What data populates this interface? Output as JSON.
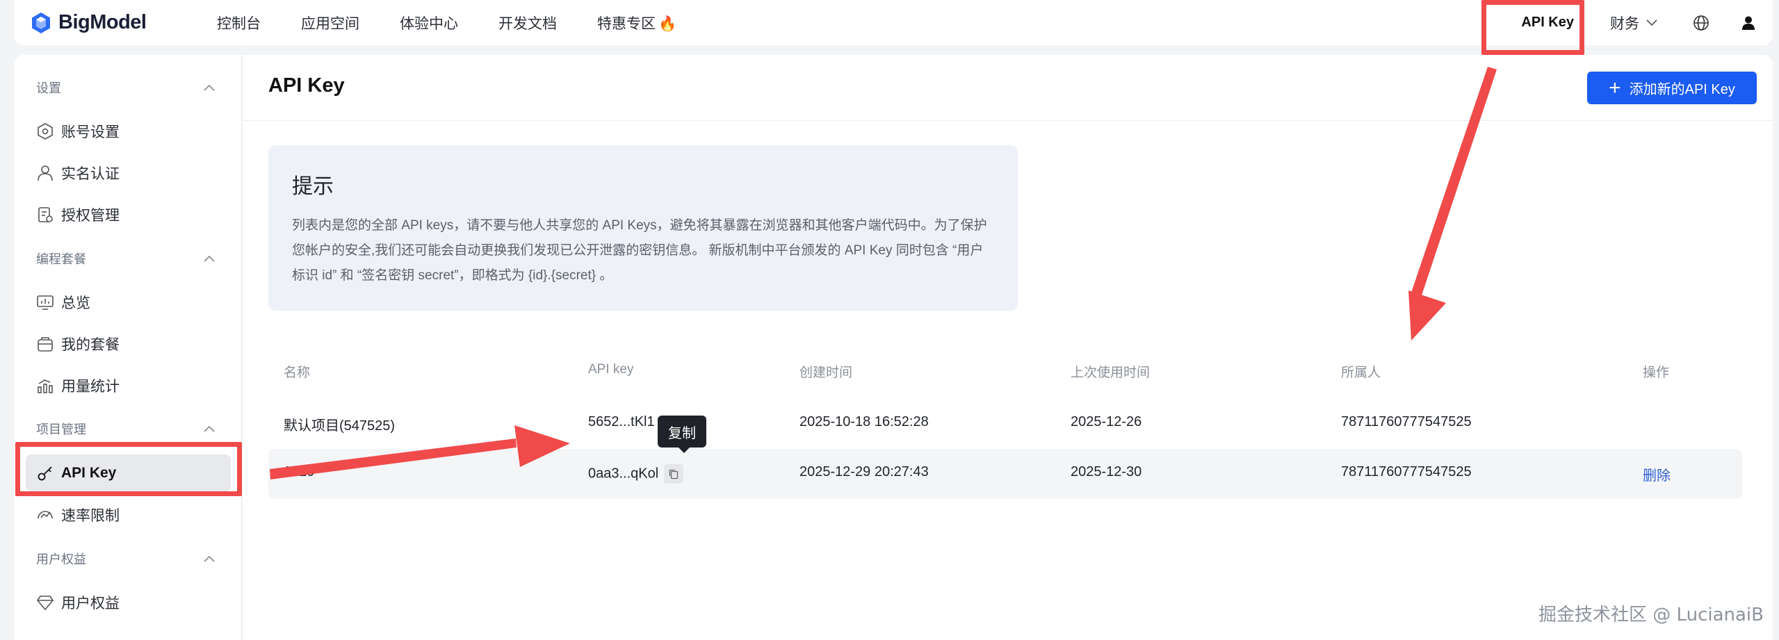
{
  "brand": {
    "name": "BigModel",
    "accent": "#1b5cf2"
  },
  "topnav": {
    "items": [
      "控制台",
      "应用空间",
      "体验中心",
      "开发文档",
      "特惠专区"
    ],
    "promo_icon": "🔥",
    "api_key": "API Key",
    "finance": "财务"
  },
  "sidebar": {
    "groups": [
      {
        "label": "设置",
        "items": [
          "账号设置",
          "实名认证",
          "授权管理"
        ]
      },
      {
        "label": "编程套餐",
        "items": [
          "总览",
          "我的套餐",
          "用量统计"
        ]
      },
      {
        "label": "项目管理",
        "items": [
          "API Key",
          "速率限制"
        ]
      },
      {
        "label": "用户权益",
        "items": [
          "用户权益"
        ]
      }
    ]
  },
  "main": {
    "title": "API Key",
    "add_button": "添加新的API Key",
    "notice": {
      "title": "提示",
      "body": "列表内是您的全部 API keys，请不要与他人共享您的 API Keys，避免将其暴露在浏览器和其他客户端代码中。为了保护您帐户的安全,我们还可能会自动更换我们发现已公开泄露的密钥信息。 新版机制中平台颁发的 API Key 同时包含 “用户标识 id” 和 “签名密钥 secret”，即格式为 {id}.{secret} 。"
    },
    "table": {
      "headers": [
        "名称",
        "API key",
        "创建时间",
        "上次使用时间",
        "所属人",
        "操作"
      ],
      "rows": [
        {
          "name": "默认项目(547525)",
          "key": "5652...tKl1",
          "created": "2025-10-18 16:52:28",
          "last_used": "2025-12-26",
          "owner": "78711760777547525",
          "action": ""
        },
        {
          "name": "1229",
          "key": "0aa3...qKol",
          "created": "2025-12-29 20:27:43",
          "last_used": "2025-12-30",
          "owner": "78711760777547525",
          "action": "删除"
        }
      ]
    },
    "tooltip": "复制"
  },
  "watermark": "掘金技术社区 @ LucianaiB"
}
